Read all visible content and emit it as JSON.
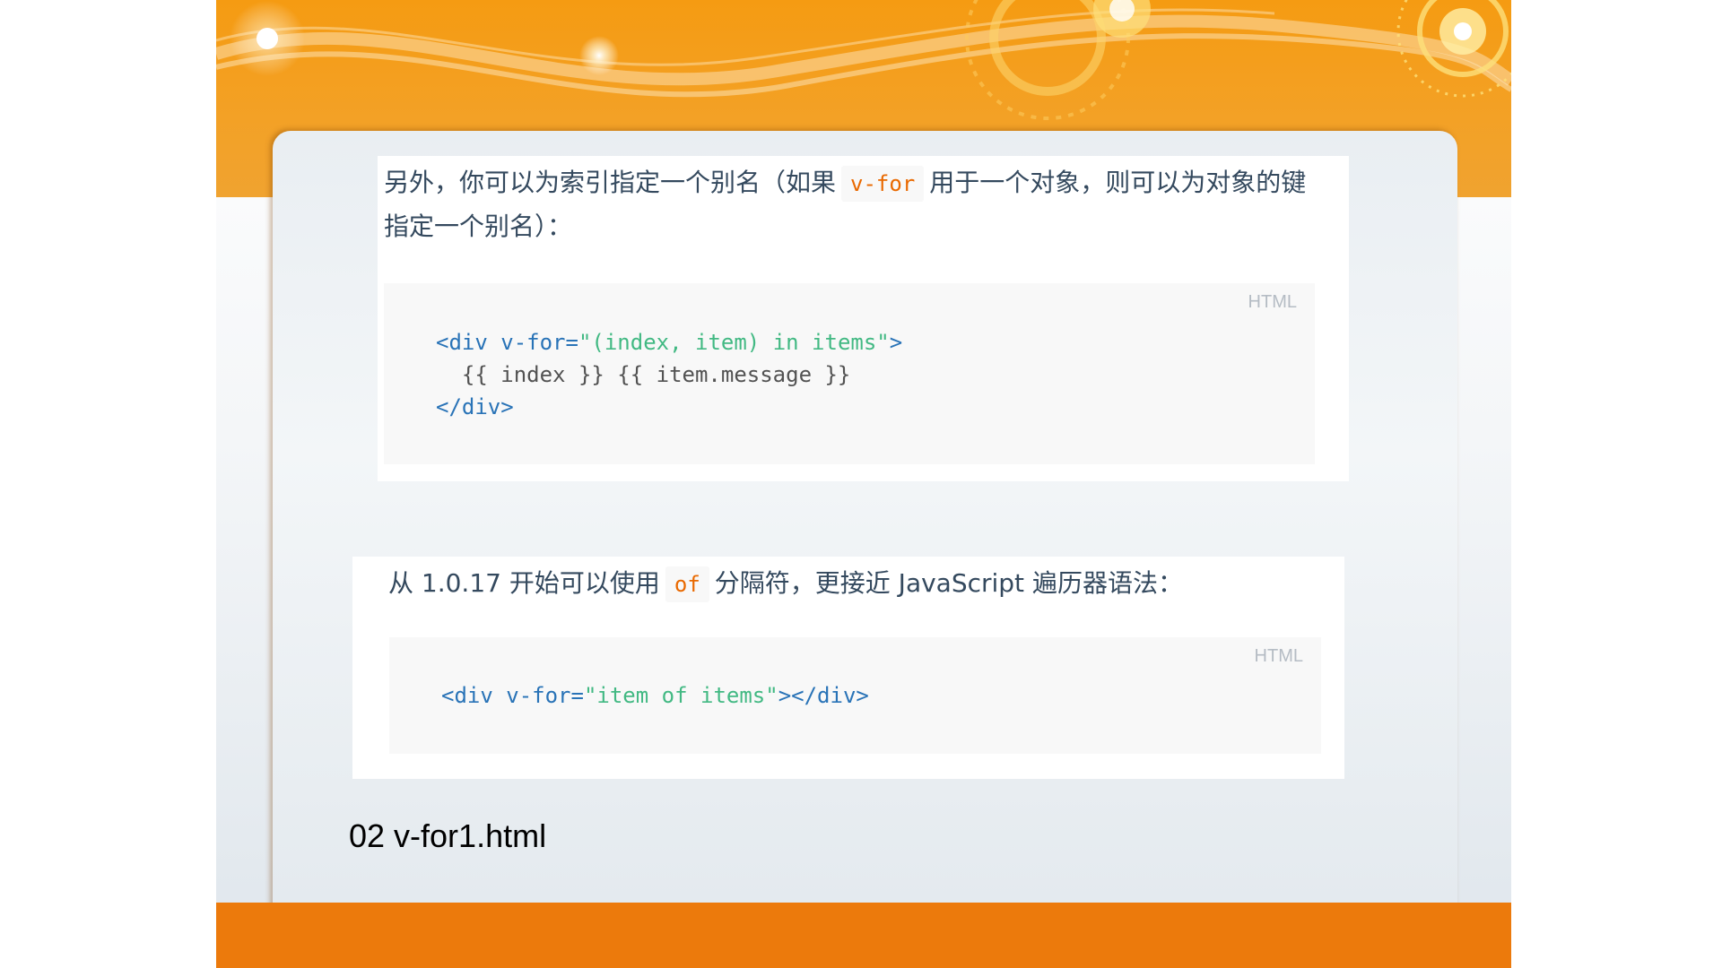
{
  "colors": {
    "banner_orange": "#f59b12",
    "footer_orange": "#ec7a0c",
    "code_tag": "#2973b7",
    "code_string": "#42b983",
    "inline_code": "#e96900"
  },
  "block1": {
    "text_before": "另外，你可以为索引指定一个别名（如果",
    "inline_code": "v-for",
    "text_after": "用于一个对象，则可以为对象的键指定一个别名）：",
    "code_lang": "HTML",
    "code": {
      "line1_open": "<div v-for=",
      "line1_attr": "\"(index, item) in items\"",
      "line1_close": ">",
      "line2": "  {{ index }} {{ item.message }}",
      "line3": "</div>"
    }
  },
  "block2": {
    "text_before": "从 1.0.17 开始可以使用",
    "inline_code": "of",
    "text_after": "分隔符，更接近 JavaScript 遍历器语法：",
    "code_lang": "HTML",
    "code": {
      "open": "<div v-for=",
      "attr": "\"item of items\"",
      "close": "></div>"
    }
  },
  "filename": "02 v-for1.html"
}
